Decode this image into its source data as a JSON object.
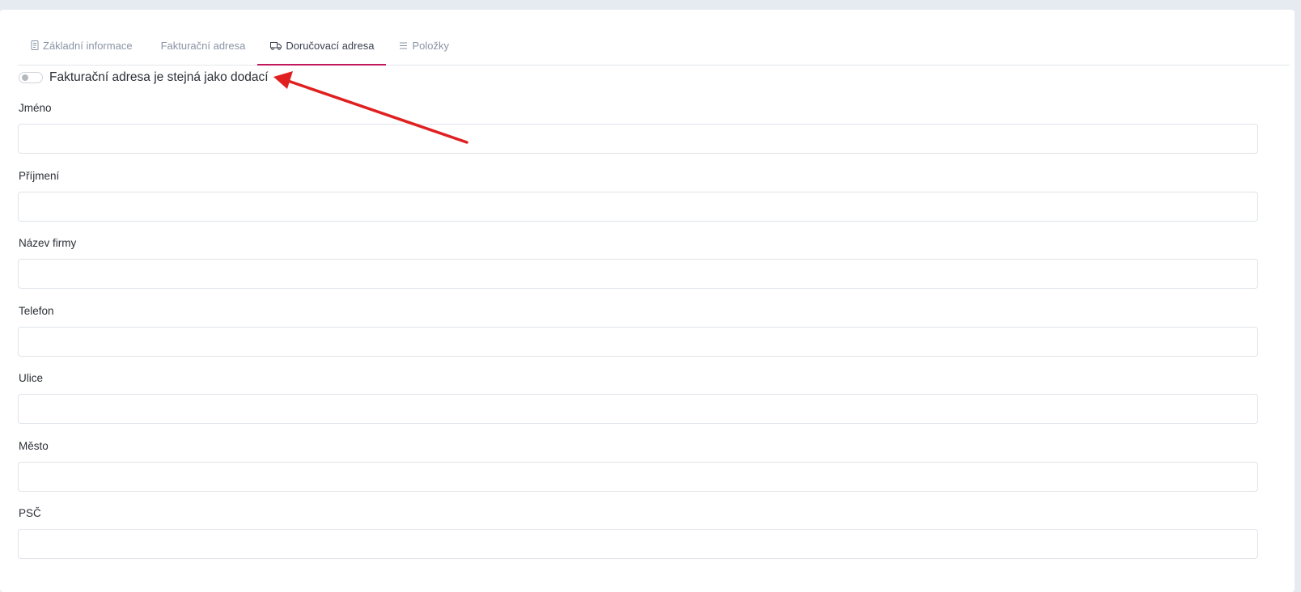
{
  "tabs": [
    {
      "label": "Základní informace",
      "icon": "document-icon",
      "active": false
    },
    {
      "label": "Fakturační adresa",
      "icon": null,
      "active": false
    },
    {
      "label": "Doručovací adresa",
      "icon": "truck-icon",
      "active": true
    },
    {
      "label": "Položky",
      "icon": "list-icon",
      "active": false
    }
  ],
  "toggle": {
    "label": "Fakturační adresa je stejná jako dodací",
    "checked": false
  },
  "fields": [
    {
      "label": "Jméno",
      "value": "",
      "placeholder": ""
    },
    {
      "label": "Příjmení",
      "value": "",
      "placeholder": ""
    },
    {
      "label": "Název firmy",
      "value": "",
      "placeholder": ""
    },
    {
      "label": "Telefon",
      "value": "",
      "placeholder": ""
    },
    {
      "label": "Ulice",
      "value": "",
      "placeholder": ""
    },
    {
      "label": "Město",
      "value": "",
      "placeholder": ""
    },
    {
      "label": "PSČ",
      "value": "",
      "placeholder": ""
    }
  ],
  "colors": {
    "active_tab_underline": "#c2185b",
    "annotation_arrow": "#e02020",
    "page_background": "#e6ebf2"
  }
}
